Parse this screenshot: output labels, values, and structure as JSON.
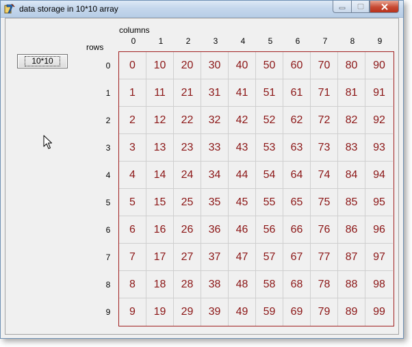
{
  "window": {
    "title": "data storage in 10*10 array"
  },
  "toolbar": {
    "fill_label": "10*10"
  },
  "labels": {
    "columns": "columns",
    "rows": "rows"
  },
  "col_indices": [
    "0",
    "1",
    "2",
    "3",
    "4",
    "5",
    "6",
    "7",
    "8",
    "9"
  ],
  "row_indices": [
    "0",
    "1",
    "2",
    "3",
    "4",
    "5",
    "6",
    "7",
    "8",
    "9"
  ],
  "grid": [
    [
      "0",
      "10",
      "20",
      "30",
      "40",
      "50",
      "60",
      "70",
      "80",
      "90"
    ],
    [
      "1",
      "11",
      "21",
      "31",
      "41",
      "51",
      "61",
      "71",
      "81",
      "91"
    ],
    [
      "2",
      "12",
      "22",
      "32",
      "42",
      "52",
      "62",
      "72",
      "82",
      "92"
    ],
    [
      "3",
      "13",
      "23",
      "33",
      "43",
      "53",
      "63",
      "73",
      "83",
      "93"
    ],
    [
      "4",
      "14",
      "24",
      "34",
      "44",
      "54",
      "64",
      "74",
      "84",
      "94"
    ],
    [
      "5",
      "15",
      "25",
      "35",
      "45",
      "55",
      "65",
      "75",
      "85",
      "95"
    ],
    [
      "6",
      "16",
      "26",
      "36",
      "46",
      "56",
      "66",
      "76",
      "86",
      "96"
    ],
    [
      "7",
      "17",
      "27",
      "37",
      "47",
      "57",
      "67",
      "77",
      "87",
      "97"
    ],
    [
      "8",
      "18",
      "28",
      "38",
      "48",
      "58",
      "68",
      "78",
      "88",
      "98"
    ],
    [
      "9",
      "19",
      "29",
      "39",
      "49",
      "59",
      "69",
      "79",
      "89",
      "99"
    ]
  ],
  "colors": {
    "cell_text": "#8b1515",
    "grid_border": "#a02020",
    "window_bg": "#f0f0f0"
  },
  "icons": {
    "app": "vb-app-icon",
    "minimize": "minimize-icon",
    "maximize": "maximize-icon",
    "close": "close-icon",
    "cursor": "mouse-pointer-icon"
  }
}
